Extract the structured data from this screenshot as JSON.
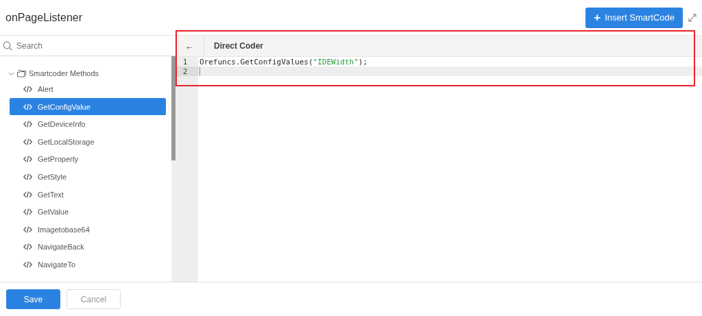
{
  "dialog": {
    "title": "onPageListener"
  },
  "insert_button": {
    "icon": "+",
    "label": "Insert SmartCode"
  },
  "search": {
    "placeholder": "Search"
  },
  "tree": [
    {
      "label": "Smartcoder Methods",
      "expanded": true,
      "children": [
        {
          "label": "Alert",
          "selected": false
        },
        {
          "label": "GetConfigValue",
          "selected": true
        },
        {
          "label": "GetDeviceInfo",
          "selected": false
        },
        {
          "label": "GetLocalStorage",
          "selected": false
        },
        {
          "label": "GetProperty",
          "selected": false
        },
        {
          "label": "GetStyle",
          "selected": false
        },
        {
          "label": "GetText",
          "selected": false
        },
        {
          "label": "GetValue",
          "selected": false
        },
        {
          "label": "Imagetobase64",
          "selected": false
        },
        {
          "label": "NavigateBack",
          "selected": false
        },
        {
          "label": "NavigateTo",
          "selected": false
        }
      ]
    }
  ],
  "editor": {
    "back": "←",
    "title": "Direct Coder",
    "lines": [
      {
        "number": "1",
        "active": false,
        "tokens": [
          {
            "text": "Orefuncs.GetConfigValues(",
            "kind": "plain"
          },
          {
            "text": "\"IDEWidth\"",
            "kind": "string"
          },
          {
            "text": ");",
            "kind": "plain"
          }
        ]
      },
      {
        "number": "2",
        "active": true
      }
    ]
  },
  "footer": {
    "buttons": [
      {
        "label": "Save",
        "kind": "primary"
      },
      {
        "label": "Cancel",
        "kind": "secondary"
      }
    ]
  }
}
